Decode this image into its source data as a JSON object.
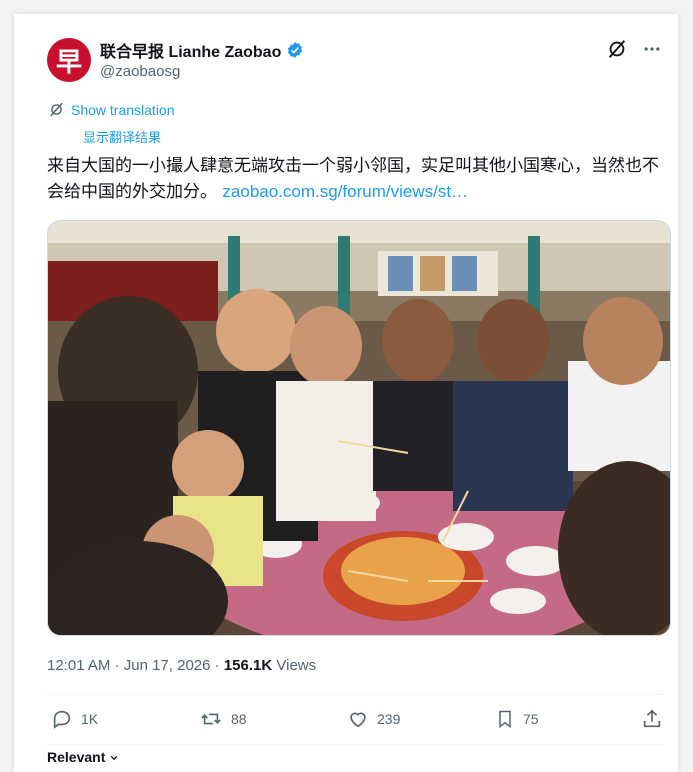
{
  "author": {
    "avatar_glyph": "早",
    "display_name": "联合早报 Lianhe Zaobao",
    "handle": "@zaobaosg",
    "brand_color": "#c8102e",
    "verified_color": "#1d9bf0"
  },
  "translation": {
    "show_label": "Show translation",
    "sub_label": "显示翻译结果"
  },
  "tweet": {
    "text": "来自大国的一小撮人肆意无端攻击一个弱小邻国，实足叫其他小国寒心，当然也不会给中国的外交加分。",
    "link": "zaobao.com.sg/forum/views/st…"
  },
  "meta": {
    "time": "12:01 AM",
    "date": "Jun 17, 2026",
    "separator": "·",
    "views_count": "156.1K",
    "views_label": "Views"
  },
  "actions": {
    "reply_count": "1K",
    "retweet_count": "88",
    "like_count": "239",
    "bookmark_count": "75"
  },
  "footer": {
    "relevant_label": "Relevant"
  },
  "icons": {
    "grok": "grok-icon",
    "more": "more-icon",
    "translate": "translate-icon",
    "reply": "reply-icon",
    "retweet": "retweet-icon",
    "like": "like-icon",
    "bookmark": "bookmark-icon",
    "share": "share-icon"
  }
}
